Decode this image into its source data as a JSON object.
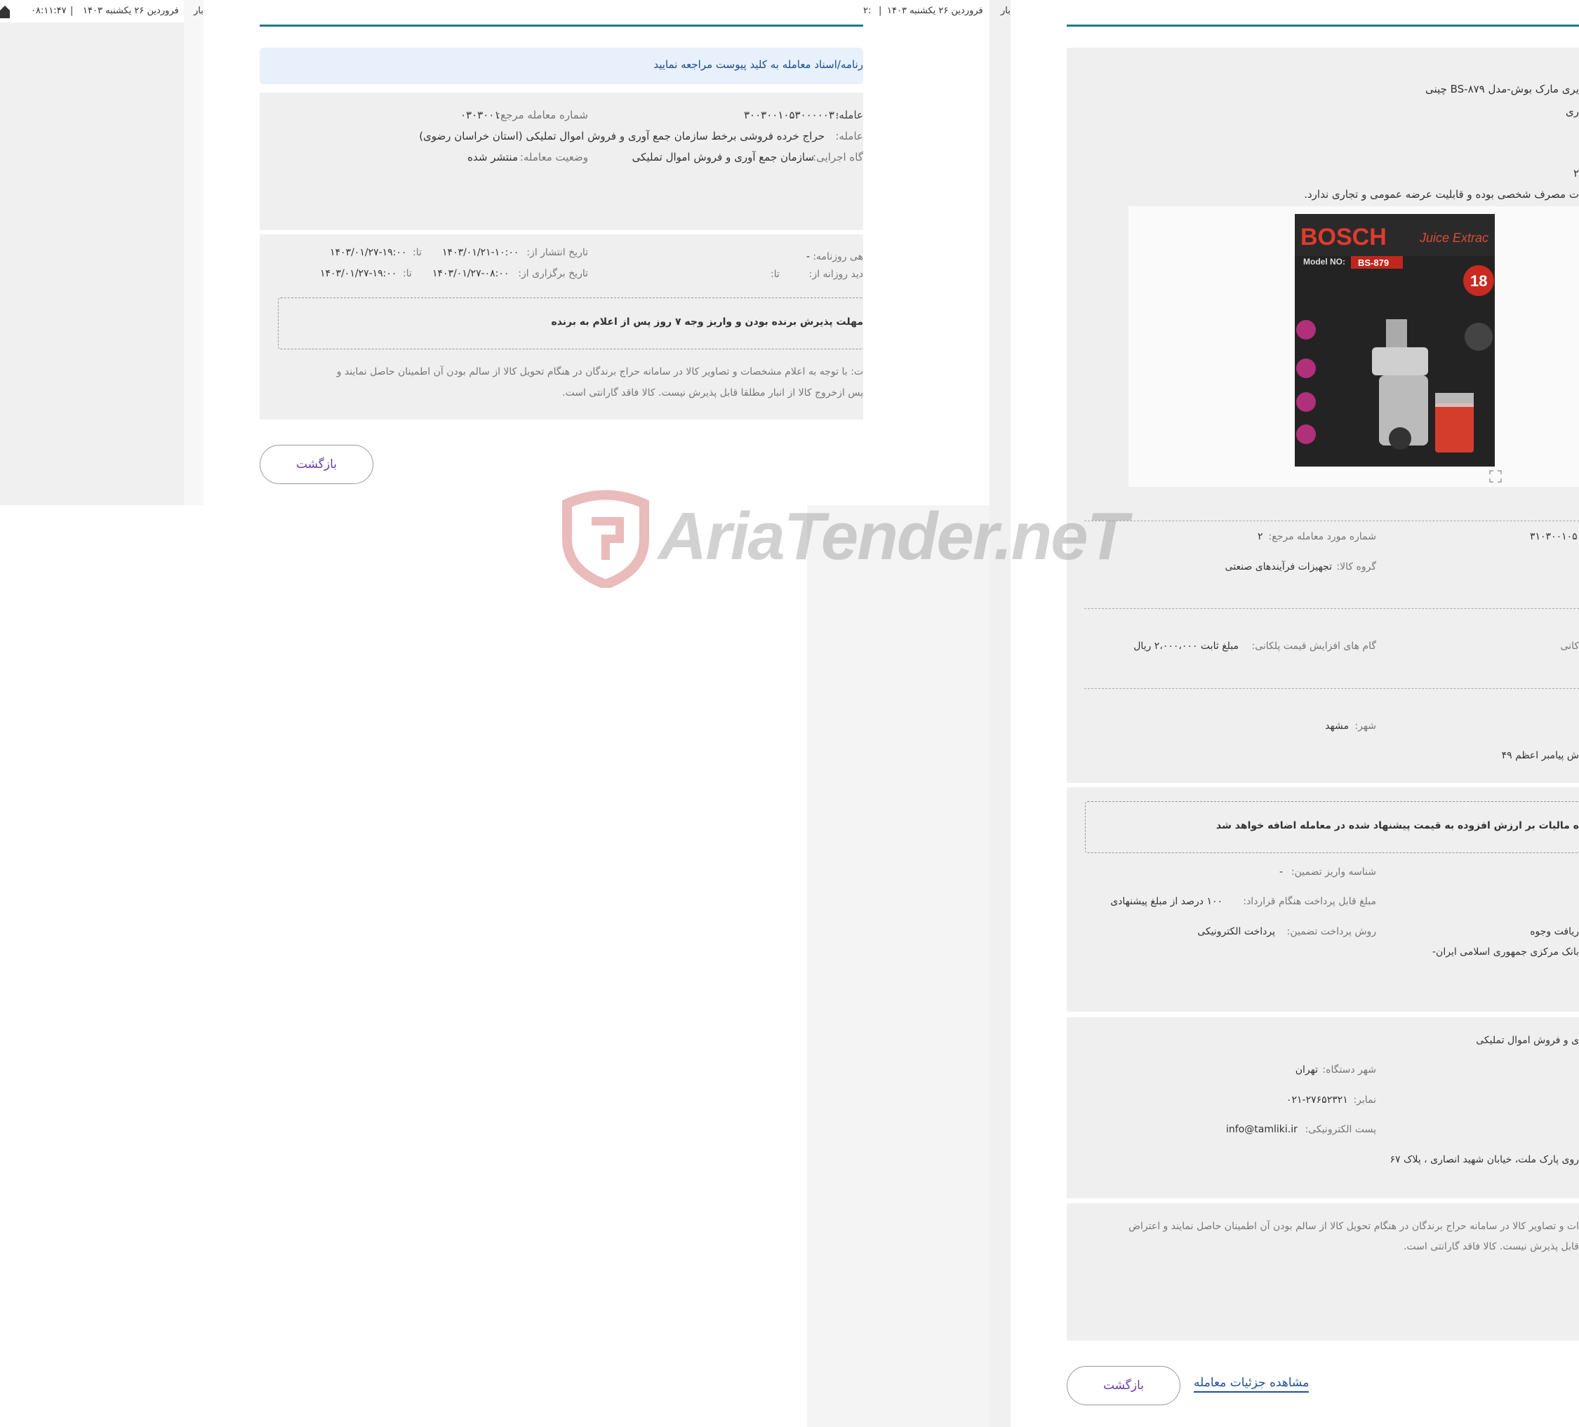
{
  "strip_left": {
    "time": "۰۸:۱۱:۴۷",
    "sep": "|",
    "date": "فروردین ۲۶ یکشنبه ۱۴۰۳",
    "fragment": "بار"
  },
  "strip_mid": {
    "sep": "|",
    "date": "فروردین ۲۶ یکشنبه ۱۴۰۳",
    "fragment": "بار",
    "fragment_left": "۲:"
  },
  "pageA": {
    "notice": "رنامه/اسناد معامله به کلید پیوست مراجعه نمایید",
    "info": {
      "deal_no_label": "عامله:",
      "deal_no_value": "۳۰۰۳۰۰۱۰۵۳۰۰۰۰۰۳۰",
      "ref_no_label": "شماره معامله مرجع:",
      "ref_no_value": "۰۳۰۳۰۰۱",
      "subject_label": "عامله:",
      "subject_value": "حراج خرده فروشی برخط سازمان جمع آوری و فروش اموال تملیکی (استان خراسان رضوی)",
      "agency_label": "گاه اجرایی:",
      "agency_value": "سازمان جمع آوری و فروش اموال تملیکی",
      "status_label": "وضعیت معامله:",
      "status_value": "منتشر شده"
    },
    "dates": {
      "daily_label": "هی روزنامه:",
      "daily_value": "-",
      "publish_label": "تاریخ انتشار از:",
      "publish_from": "۱۴۰۳/۰۱/۲۱-۱۰:۰۰",
      "publish_to_label": "تا:",
      "publish_to": "۱۴۰۳/۰۱/۲۷-۱۹:۰۰",
      "renew_label": "دید روزانه از:",
      "renew_to_label": "تا:",
      "hold_label": "تاریخ برگزاری از:",
      "hold_from": "۱۴۰۳/۰۱/۲۷-۰۸:۰۰",
      "hold_to_label": "تا:",
      "hold_to": "۱۴۰۳/۰۱/۲۷-۱۹:۰۰"
    },
    "deadline": "مهلت پذیرش برنده بودن و واریز وجه ۷ روز پس از اعلام به برنده",
    "note_line1": "ت: با توجه به اعلام مشخصات و تصاویر کالا در سامانه حراج برندگان در هنگام تحویل کالا از سالم بودن آن اطمینان حاصل نمایند و",
    "note_line2": "پس ازخروج کالا از انبار مطلقا قابل پذیرش نیست. کالا فاقد گارانتی است.",
    "back_button": "بازگشت"
  },
  "watermark": "AriaTender.neT",
  "pageB": {
    "title_line": "یری مارک بوش-مدل BS-۸۷۹ چینی",
    "line2": "ری",
    "line3": "۲",
    "consumption": "ت مصرف شخصی بوده و قابلیت عرضه عمومی و تجاری ندارد.",
    "product_image": {
      "brand": "BOSCH",
      "model_label": "Model NO:",
      "model": "BS-879",
      "juice": "Juice Extrac",
      "badge": "18"
    },
    "expand_icon": "expand-icon",
    "item_ref_label": "شماره مورد معامله مرجع:",
    "item_ref_value": "۲",
    "item_no_fragment": "۳۱۰۳۰۰۱۰۵",
    "group_label": "گروه کالا:",
    "group_value": "تجهیزات فرآیندهای صنعتی",
    "step_label": "گام های افزایش قیمت پلکانی:",
    "step_value": "مبلغ ثابت ۲،۰۰۰،۰۰۰ ریال",
    "step_left_fragment": "کانی",
    "city_label": "شهر:",
    "city_value": "مشهد",
    "address_fragment": "ش پیامبر اعظم ۴۹",
    "vat_notice": "ه مالیات بر ارزش افزوده به قیمت پیشنهاد شده در معامله اضافه خواهد شد",
    "guarantee_id_label": "شناسه واریز تضمین:",
    "guarantee_id_value": "-",
    "payable_label": "مبلغ قابل پرداخت هنگام قرارداد:",
    "payable_value": "۱۰۰ درصد از مبلغ پیشنهادی",
    "pay_method_label": "روش پرداخت تضمین:",
    "pay_method_value": "پرداخت الکترونیکی",
    "receive_fragment": "ریافت وجوه",
    "bank_fragment": "بانک مرکزی جمهوری اسلامی ایران-",
    "org_fragment": "ی و فروش اموال تملیکی",
    "org_city_label": "شهر دستگاه:",
    "org_city_value": "تهران",
    "fax_label": "نمابر:",
    "fax_value": "۰۲۱-۲۷۶۵۲۳۲۱",
    "email_label": "پست الکترونیکی:",
    "email_value": "info@tamliki.ir",
    "org_address_fragment": "روی پارک ملت، خیابان شهید انصاری ، پلاک ۶۷",
    "note_line1": "ات و تصاویر کالا در سامانه حراج برندگان در هنگام تحویل کالا از سالم بودن آن اطمینان حاصل نمایند و اعتراض",
    "note_line2": "قابل پذیرش نیست. کالا فاقد گارانتی است.",
    "back_button": "بازگشت",
    "details_link": "مشاهده جزئیات معامله"
  },
  "colors": {
    "accent_line": "#1d7a8a",
    "button_text": "#6a3fa0",
    "link": "#1e4f9c",
    "panel": "#efefef",
    "notice_bg": "#e7f0fb",
    "watermark_red": "#d98585",
    "watermark_gray": "#9a9a9a"
  }
}
